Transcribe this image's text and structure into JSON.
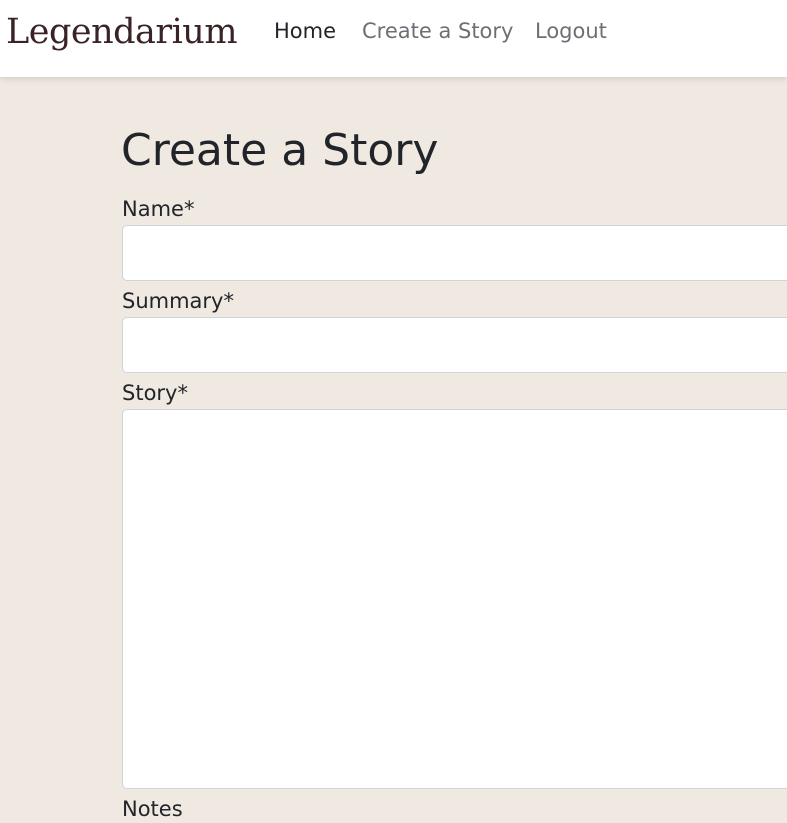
{
  "navbar": {
    "brand": "Legendarium",
    "links": [
      {
        "label": "Home",
        "active": true
      },
      {
        "label": "Create a Story",
        "active": false
      },
      {
        "label": "Logout",
        "active": false
      }
    ]
  },
  "page": {
    "title": "Create a Story"
  },
  "form": {
    "name": {
      "label": "Name*",
      "value": ""
    },
    "summary": {
      "label": "Summary*",
      "value": ""
    },
    "story": {
      "label": "Story*",
      "value": ""
    },
    "notes": {
      "label": "Notes"
    }
  },
  "colors": {
    "page_background": "#efe9e1",
    "navbar_background": "#ffffff",
    "brand_color": "#3a2326",
    "active_link": "#212529",
    "inactive_link": "#6c7075"
  }
}
